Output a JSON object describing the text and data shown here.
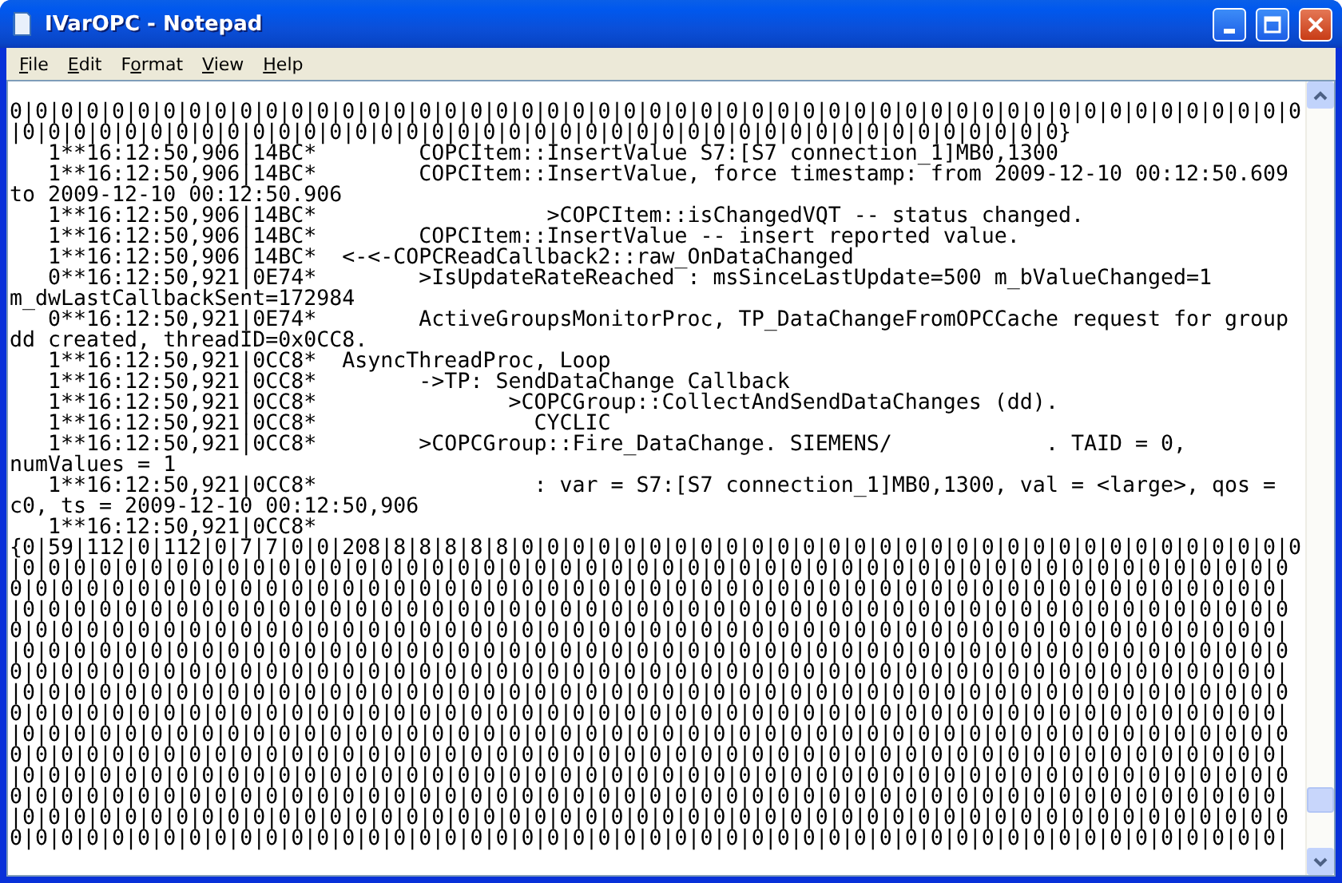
{
  "window": {
    "title": "IVarOPC - Notepad"
  },
  "menu": [
    {
      "key": "F",
      "post": "ile"
    },
    {
      "key": "E",
      "post": "dit"
    },
    {
      "pre": "F",
      "key": "o",
      "post": "rmat"
    },
    {
      "key": "V",
      "post": "iew"
    },
    {
      "key": "H",
      "post": "elp"
    }
  ],
  "editor": {
    "lines": [
      "0|0|0|0|0|0|0|0|0|0|0|0|0|0|0|0|0|0|0|0|0|0|0|0|0|0|0|0|0|0|0|0|0|0|0|0|0|0|0|0|0|0|0|0|0|0|0|0|0|0|0",
      "|0|0|0|0|0|0|0|0|0|0|0|0|0|0|0|0|0|0|0|0|0|0|0|0|0|0|0|0|0|0|0|0|0|0|0|0|0|0|0|0|0}",
      "   1**16:12:50,906|14BC*        COPCItem::InsertValue S7:[S7 connection_1]MB0,1300",
      "   1**16:12:50,906|14BC*        COPCItem::InsertValue, force timestamp: from 2009-12-10 00:12:50.609",
      "to 2009-12-10 00:12:50.906",
      "   1**16:12:50,906|14BC*                  >COPCItem::isChangedVQT -- status changed.",
      "   1**16:12:50,906|14BC*        COPCItem::InsertValue -- insert reported value.",
      "   1**16:12:50,906|14BC*  <-<-COPCReadCallback2::raw_OnDataChanged",
      "   0**16:12:50,921|0E74*        >IsUpdateRateReached : msSinceLastUpdate=500 m_bValueChanged=1",
      "m_dwLastCallbackSent=172984",
      "   0**16:12:50,921|0E74*        ActiveGroupsMonitorProc, TP_DataChangeFromOPCCache request for group",
      "dd created, threadID=0x0CC8.",
      "   1**16:12:50,921|0CC8*  AsyncThreadProc, Loop",
      "   1**16:12:50,921|0CC8*        ->TP: SendDataChange Callback",
      "   1**16:12:50,921|0CC8*               >COPCGroup::CollectAndSendDataChanges (dd).",
      "   1**16:12:50,921|0CC8*                 CYCLIC",
      "   1**16:12:50,921|0CC8*        >COPCGroup::Fire_DataChange. SIEMENS/            . TAID = 0,",
      "numValues = 1",
      "   1**16:12:50,921|0CC8*                 : var = S7:[S7 connection_1]MB0,1300, val = <large>, qos =",
      "c0, ts = 2009-12-10 00:12:50,906",
      "   1**16:12:50,921|0CC8*",
      "{0|59|112|0|112|0|7|7|0|0|208|8|8|8|8|8|0|0|0|0|0|0|0|0|0|0|0|0|0|0|0|0|0|0|0|0|0|0|0|0|0|0|0|0|0|0|0",
      "|0|0|0|0|0|0|0|0|0|0|0|0|0|0|0|0|0|0|0|0|0|0|0|0|0|0|0|0|0|0|0|0|0|0|0|0|0|0|0|0|0|0|0|0|0|0|0|0|0|0",
      "0|0|0|0|0|0|0|0|0|0|0|0|0|0|0|0|0|0|0|0|0|0|0|0|0|0|0|0|0|0|0|0|0|0|0|0|0|0|0|0|0|0|0|0|0|0|0|0|0|0|",
      "|0|0|0|0|0|0|0|0|0|0|0|0|0|0|0|0|0|0|0|0|0|0|0|0|0|0|0|0|0|0|0|0|0|0|0|0|0|0|0|0|0|0|0|0|0|0|0|0|0|0",
      "0|0|0|0|0|0|0|0|0|0|0|0|0|0|0|0|0|0|0|0|0|0|0|0|0|0|0|0|0|0|0|0|0|0|0|0|0|0|0|0|0|0|0|0|0|0|0|0|0|0|",
      "|0|0|0|0|0|0|0|0|0|0|0|0|0|0|0|0|0|0|0|0|0|0|0|0|0|0|0|0|0|0|0|0|0|0|0|0|0|0|0|0|0|0|0|0|0|0|0|0|0|0",
      "0|0|0|0|0|0|0|0|0|0|0|0|0|0|0|0|0|0|0|0|0|0|0|0|0|0|0|0|0|0|0|0|0|0|0|0|0|0|0|0|0|0|0|0|0|0|0|0|0|0|",
      "|0|0|0|0|0|0|0|0|0|0|0|0|0|0|0|0|0|0|0|0|0|0|0|0|0|0|0|0|0|0|0|0|0|0|0|0|0|0|0|0|0|0|0|0|0|0|0|0|0|0",
      "0|0|0|0|0|0|0|0|0|0|0|0|0|0|0|0|0|0|0|0|0|0|0|0|0|0|0|0|0|0|0|0|0|0|0|0|0|0|0|0|0|0|0|0|0|0|0|0|0|0|",
      "|0|0|0|0|0|0|0|0|0|0|0|0|0|0|0|0|0|0|0|0|0|0|0|0|0|0|0|0|0|0|0|0|0|0|0|0|0|0|0|0|0|0|0|0|0|0|0|0|0|0",
      "0|0|0|0|0|0|0|0|0|0|0|0|0|0|0|0|0|0|0|0|0|0|0|0|0|0|0|0|0|0|0|0|0|0|0|0|0|0|0|0|0|0|0|0|0|0|0|0|0|0|",
      "|0|0|0|0|0|0|0|0|0|0|0|0|0|0|0|0|0|0|0|0|0|0|0|0|0|0|0|0|0|0|0|0|0|0|0|0|0|0|0|0|0|0|0|0|0|0|0|0|0|0",
      "0|0|0|0|0|0|0|0|0|0|0|0|0|0|0|0|0|0|0|0|0|0|0|0|0|0|0|0|0|0|0|0|0|0|0|0|0|0|0|0|0|0|0|0|0|0|0|0|0|0|",
      "|0|0|0|0|0|0|0|0|0|0|0|0|0|0|0|0|0|0|0|0|0|0|0|0|0|0|0|0|0|0|0|0|0|0|0|0|0|0|0|0|0|0|0|0|0|0|0|0|0|0",
      "0|0|0|0|0|0|0|0|0|0|0|0|0|0|0|0|0|0|0|0|0|0|0|0|0|0|0|0|0|0|0|0|0|0|0|0|0|0|0|0|0|0|0|0|0|0|0|0|0|0|"
    ]
  }
}
